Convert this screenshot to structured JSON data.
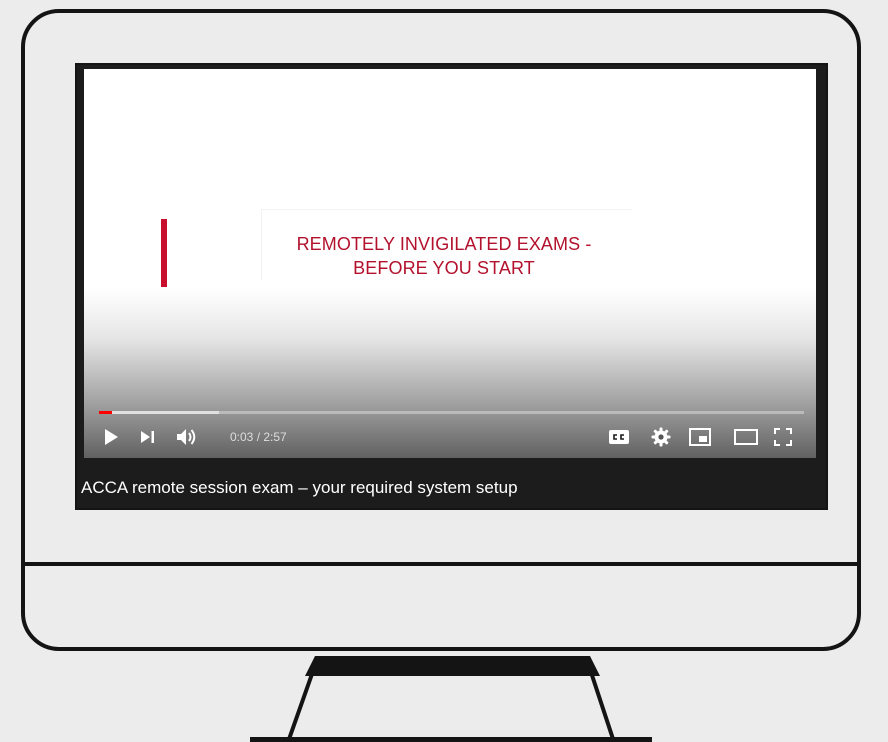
{
  "video": {
    "slide_title_line1": "REMOTELY INVIGILATED EXAMS -",
    "slide_title_line2": "BEFORE YOU START",
    "title": "ACCA remote session exam – your required system setup",
    "time_display": "0:03 / 2:57",
    "progress_fraction": 0.018,
    "buffered_fraction": 0.17
  },
  "controls": {
    "icons": [
      "play-icon",
      "next-icon",
      "volume-icon",
      "subtitles-icon",
      "settings-icon",
      "miniplayer-icon",
      "theater-mode-icon",
      "fullscreen-icon"
    ]
  },
  "colors": {
    "accent_red": "#c8102e",
    "progress_red": "#ff0000",
    "frame": "#141414",
    "background": "#ececec"
  }
}
